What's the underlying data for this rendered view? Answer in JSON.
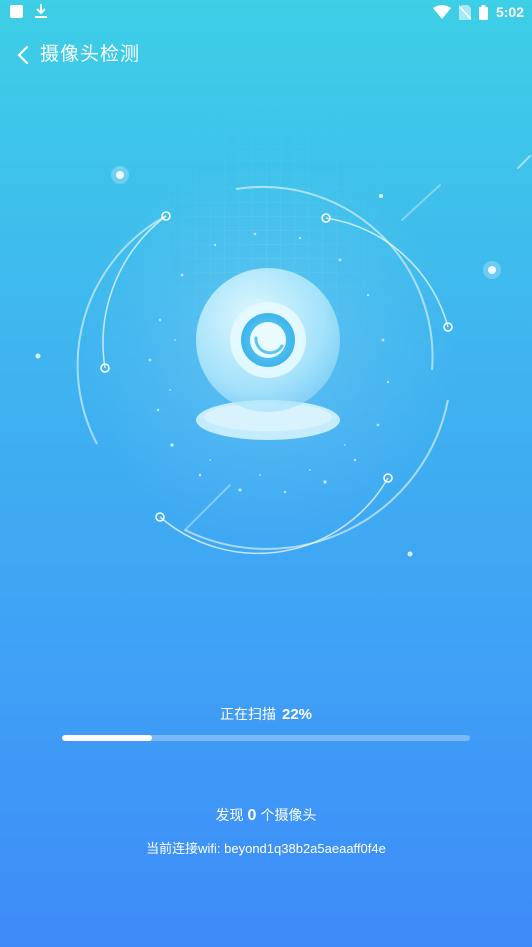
{
  "status_bar": {
    "time": "5:02",
    "icons": [
      "notification-square-icon",
      "download-icon",
      "wifi-icon",
      "no-sim-icon",
      "battery-icon"
    ]
  },
  "header": {
    "back_icon": "chevron-left-icon",
    "title": "摄像头检测"
  },
  "illustration": {
    "icon": "webcam-icon"
  },
  "scan": {
    "label": "正在扫描",
    "percent_text": "22%",
    "progress": 0.22
  },
  "result": {
    "prefix": "发现",
    "count": "0",
    "suffix": "个摄像头"
  },
  "wifi": {
    "text": "当前连接wifi: beyond1q38b2a5aeaaff0f4e"
  },
  "colors": {
    "background_top": "#3dcfe6",
    "background_bottom": "#3d8bf8",
    "foreground": "#ffffff"
  }
}
